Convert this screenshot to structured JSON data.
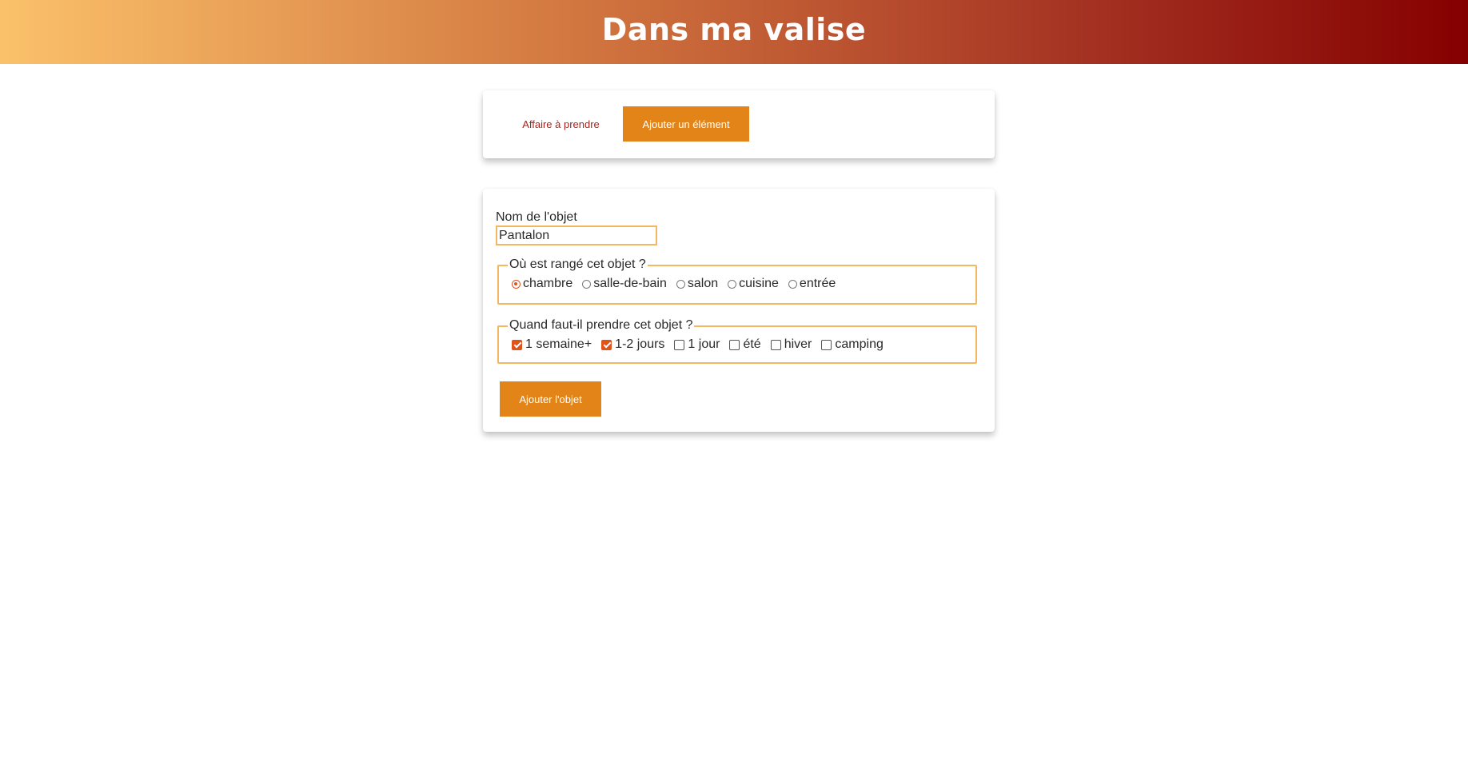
{
  "header": {
    "title": "Dans ma valise"
  },
  "nav": {
    "tabs": [
      {
        "label": "Affaire à prendre",
        "active": false
      },
      {
        "label": "Ajouter un élément",
        "active": true
      }
    ]
  },
  "form": {
    "name_label": "Nom de l'objet",
    "name_value": "Pantalon",
    "location": {
      "legend": "Où est rangé cet objet ?",
      "options": [
        {
          "label": "chambre",
          "selected": true
        },
        {
          "label": "salle-de-bain",
          "selected": false
        },
        {
          "label": "salon",
          "selected": false
        },
        {
          "label": "cuisine",
          "selected": false
        },
        {
          "label": "entrée",
          "selected": false
        }
      ]
    },
    "when": {
      "legend": "Quand faut-il prendre cet objet ?",
      "options": [
        {
          "label": "1 semaine+",
          "checked": true
        },
        {
          "label": "1-2 jours",
          "checked": true
        },
        {
          "label": "1 jour",
          "checked": false
        },
        {
          "label": "été",
          "checked": false
        },
        {
          "label": "hiver",
          "checked": false
        },
        {
          "label": "camping",
          "checked": false
        }
      ]
    },
    "submit_label": "Ajouter l'objet"
  },
  "colors": {
    "accent": "#e38419",
    "check": "#e0531a",
    "border": "#f3b661",
    "link": "#a8241c"
  }
}
